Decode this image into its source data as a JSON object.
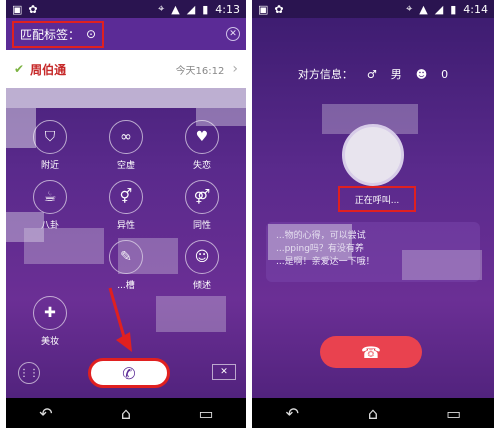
{
  "left": {
    "status": {
      "time": "4:13"
    },
    "tag_label": "匹配标签：",
    "contact": {
      "name": "周伯通",
      "time": "今天16:12"
    },
    "tiles": [
      {
        "label": "附近",
        "icon": "shield-icon"
      },
      {
        "label": "空虚",
        "icon": "link-icon"
      },
      {
        "label": "失恋",
        "icon": "broken-heart-icon"
      },
      {
        "label": "八卦",
        "icon": "cup-icon"
      },
      {
        "label": "异性",
        "icon": "gender-icon"
      },
      {
        "label": "同性",
        "icon": "gender-icon"
      },
      {
        "label": "...槽",
        "icon": "chat-icon"
      },
      {
        "label": "倾述",
        "icon": "people-icon"
      },
      {
        "label": "美妆",
        "icon": "makeup-icon"
      }
    ]
  },
  "right": {
    "status": {
      "time": "4:14"
    },
    "peer_info_label": "对方信息：",
    "gender": "男",
    "count": "0",
    "calling_text": "正在呼叫...",
    "bubble_lines": [
      "...物的心得，可以尝试",
      "...pping吗？有没有养",
      "...是啊！亲爱达一下哦！"
    ]
  }
}
